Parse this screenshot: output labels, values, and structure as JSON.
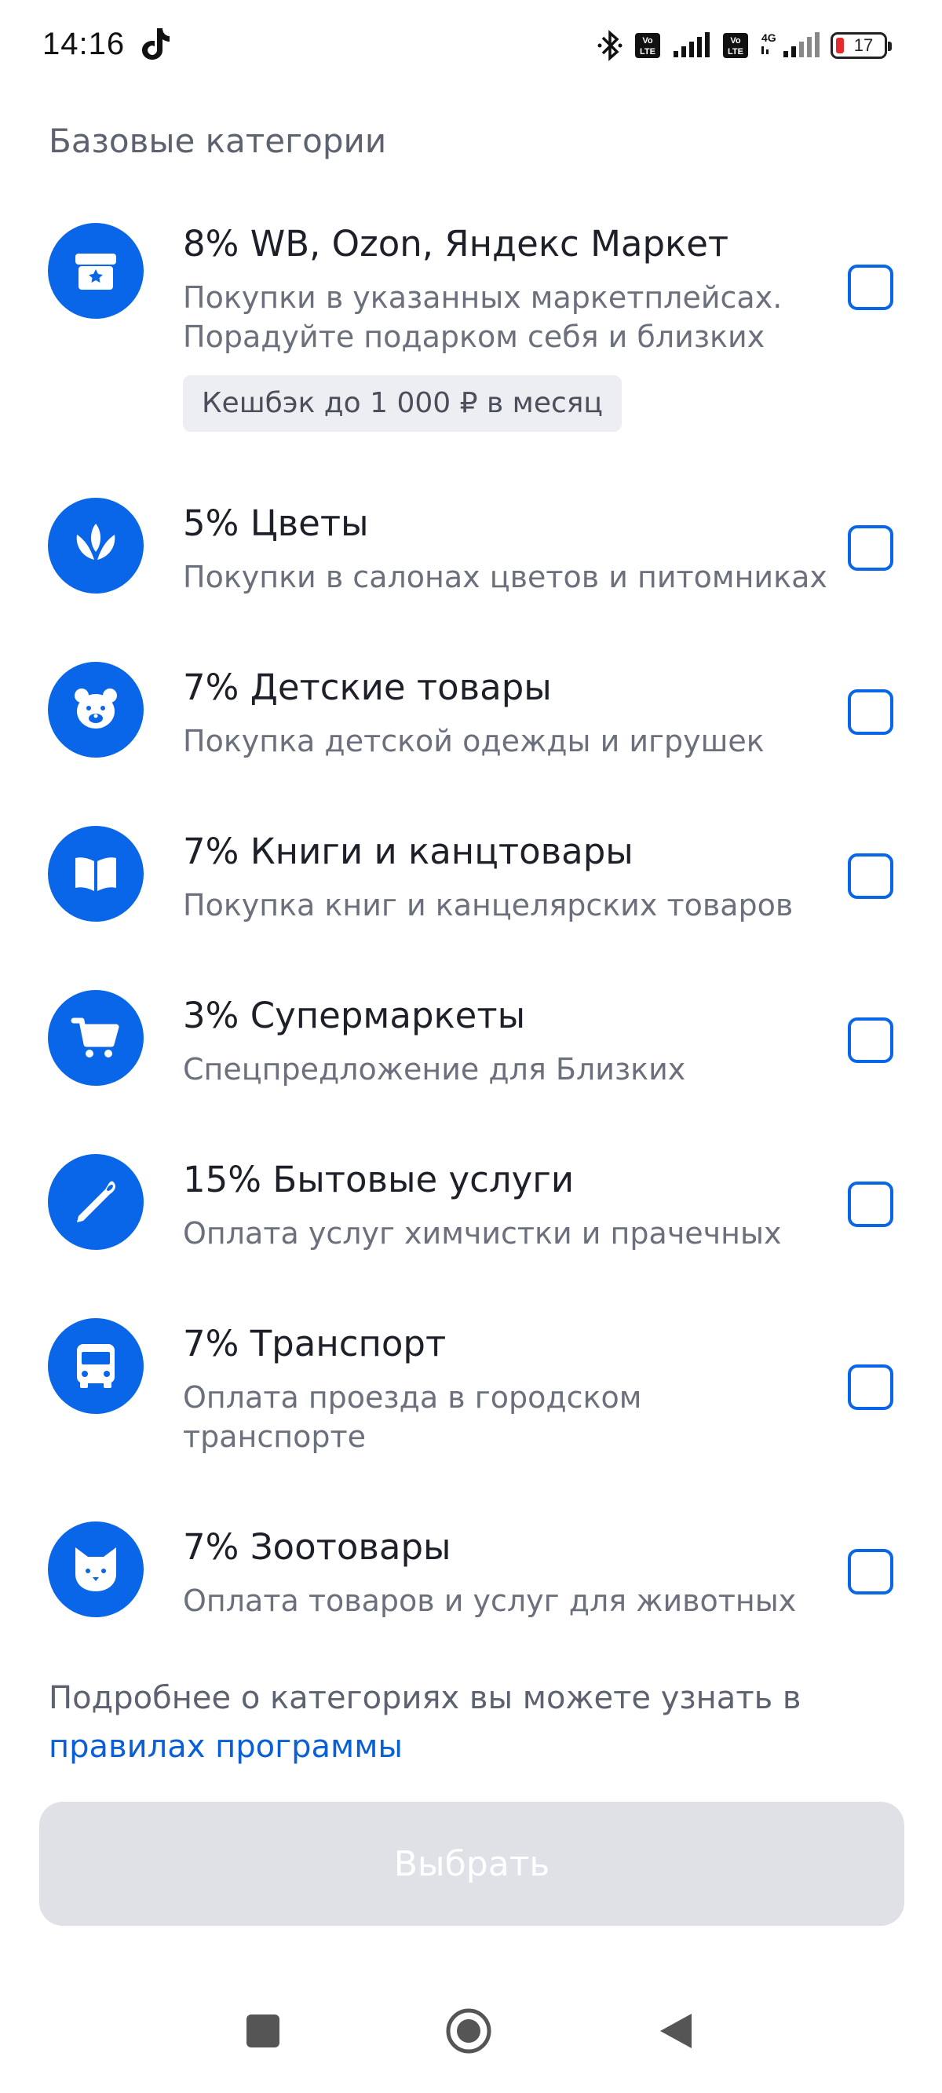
{
  "status_bar": {
    "time": "14:16",
    "battery_level": "17",
    "icons": [
      "tiktok-icon",
      "bluetooth-icon",
      "volte-icon",
      "signal-icon",
      "4g-icon",
      "battery-icon"
    ]
  },
  "section_title": "Базовые категории",
  "categories": [
    {
      "icon": "marketplace-box-icon",
      "title": "8% WB, Ozon, Яндекс Маркет",
      "desc_line1": "Покупки в указанных маркетплейсах.",
      "desc_line2": "Порадуйте подарком себя и близких",
      "badge": "Кешбэк до 1 000 ₽ в месяц",
      "checked": false
    },
    {
      "icon": "flower-icon",
      "title": "5% Цветы",
      "desc_line1": "Покупки в салонах цветов и питомниках",
      "checked": false
    },
    {
      "icon": "teddy-bear-icon",
      "title": "7% Детские товары",
      "desc_line1": "Покупка детской одежды и игрушек",
      "checked": false
    },
    {
      "icon": "book-icon",
      "title": "7% Книги и канцтовары",
      "desc_line1": "Покупка книг и канцелярских товаров",
      "checked": false
    },
    {
      "icon": "shopping-cart-icon",
      "title": "3% Супермаркеты",
      "desc_line1": "Спецпредложение для Близких",
      "checked": false
    },
    {
      "icon": "needle-icon",
      "title": "15% Бытовые услуги",
      "desc_line1": "Оплата услуг химчистки и прачечных",
      "checked": false
    },
    {
      "icon": "bus-icon",
      "title": "7% Транспорт",
      "desc_line1": "Оплата проезда в городском",
      "desc_line2": "транспорте",
      "checked": false
    },
    {
      "icon": "cat-icon",
      "title": "7% Зоотовары",
      "desc_line1": "Оплата товаров и услуг для животных",
      "checked": false
    }
  ],
  "footnote": {
    "text": "Подробнее о категориях вы можете узнать в",
    "link": "правилах программы"
  },
  "primary_button": {
    "label": "Выбрать",
    "enabled": false
  },
  "nav_bar": {
    "icons": [
      "recents-square-icon",
      "home-circle-icon",
      "back-triangle-icon"
    ]
  },
  "colors": {
    "accent": "#0a66e8",
    "link": "#0a5fd7",
    "button_disabled": "#dfe1e6"
  }
}
